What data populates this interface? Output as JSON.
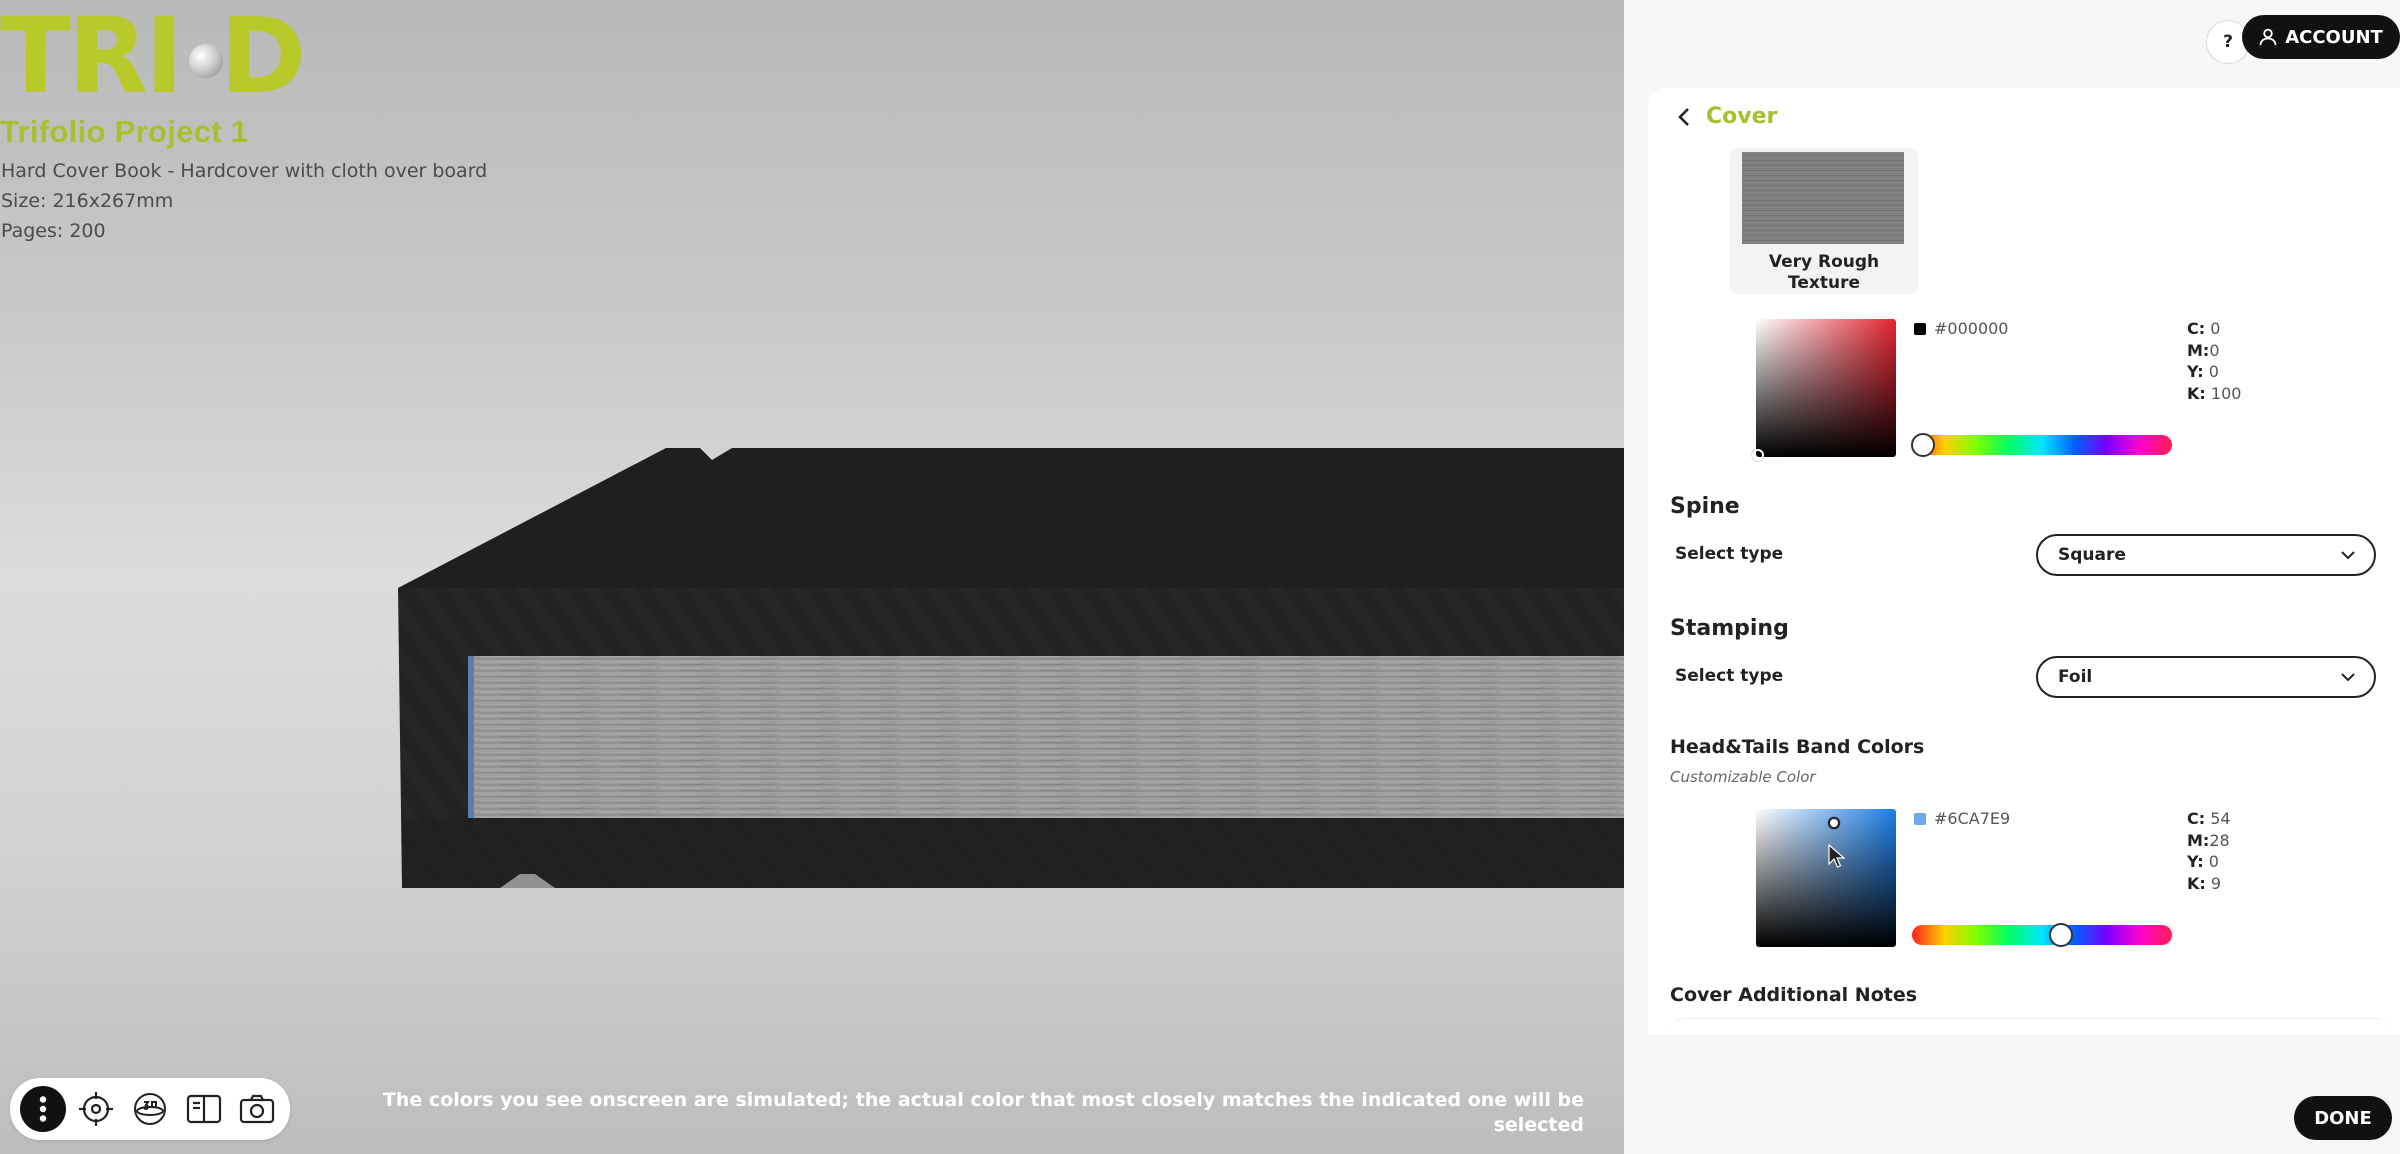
{
  "brand": {
    "logo_left": "TRI",
    "logo_right": "D",
    "logo_color": "#b8c92a"
  },
  "project": {
    "title": "Trifolio Project 1",
    "description": "Hard Cover Book - Hardcover with cloth over board",
    "size": "Size: 216x267mm",
    "pages": "Pages: 200"
  },
  "viewer": {
    "disclaimer": "The colors you see onscreen are simulated; the actual color that most closely matches the indicated one will be selected",
    "tools": [
      "menu-dots-icon",
      "crosshair-icon",
      "rotate-360-icon",
      "open-book-icon",
      "camera-icon"
    ]
  },
  "header": {
    "help_label": "?",
    "account_label": "ACCOUNT"
  },
  "cover": {
    "title": "Cover",
    "texture_label": "Very Rough Texture",
    "color": {
      "hex": "#000000",
      "c_label": "C:",
      "c": "0",
      "m_label": "M:",
      "m": "0",
      "y_label": "Y:",
      "y": "0",
      "k_label": "K:",
      "k": "100",
      "hue_fraction": 0.0,
      "base_hue_color": "#e4242f"
    }
  },
  "spine": {
    "heading": "Spine",
    "select_label": "Select type",
    "value": "Square"
  },
  "stamping": {
    "heading": "Stamping",
    "select_label": "Select type",
    "value": "Foil"
  },
  "head_tails": {
    "heading": "Head&Tails Band Colors",
    "note": "Customizable Color",
    "color": {
      "hex": "#6CA7E9",
      "c_label": "C:",
      "c": "54",
      "m_label": "M:",
      "m": "28",
      "y_label": "Y:",
      "y": "0",
      "k_label": "K:",
      "k": "9",
      "hue_fraction": 0.58,
      "base_hue_color": "#1c7fe8"
    }
  },
  "notes": {
    "heading": "Cover Additional Notes"
  },
  "footer": {
    "done_label": "DONE"
  },
  "colors": {
    "accent": "#a6bf2f",
    "dark": "#111111"
  }
}
